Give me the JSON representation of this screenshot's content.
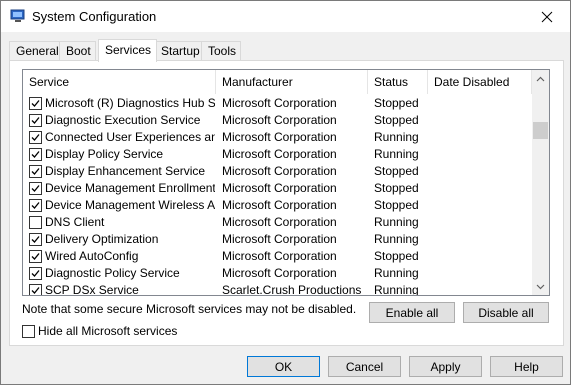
{
  "window": {
    "title": "System Configuration"
  },
  "tabs": [
    {
      "label": "General",
      "active": false
    },
    {
      "label": "Boot",
      "active": false
    },
    {
      "label": "Services",
      "active": true
    },
    {
      "label": "Startup",
      "active": false
    },
    {
      "label": "Tools",
      "active": false
    }
  ],
  "table": {
    "columns": [
      "Service",
      "Manufacturer",
      "Status",
      "Date Disabled"
    ],
    "rows": [
      {
        "checked": true,
        "service": "Microsoft (R) Diagnostics Hub St...",
        "manufacturer": "Microsoft Corporation",
        "status": "Stopped",
        "date_disabled": ""
      },
      {
        "checked": true,
        "service": "Diagnostic Execution Service",
        "manufacturer": "Microsoft Corporation",
        "status": "Stopped",
        "date_disabled": ""
      },
      {
        "checked": true,
        "service": "Connected User Experiences an...",
        "manufacturer": "Microsoft Corporation",
        "status": "Running",
        "date_disabled": ""
      },
      {
        "checked": true,
        "service": "Display Policy Service",
        "manufacturer": "Microsoft Corporation",
        "status": "Running",
        "date_disabled": ""
      },
      {
        "checked": true,
        "service": "Display Enhancement Service",
        "manufacturer": "Microsoft Corporation",
        "status": "Stopped",
        "date_disabled": ""
      },
      {
        "checked": true,
        "service": "Device Management Enrollment ...",
        "manufacturer": "Microsoft Corporation",
        "status": "Stopped",
        "date_disabled": ""
      },
      {
        "checked": true,
        "service": "Device Management Wireless Ap...",
        "manufacturer": "Microsoft Corporation",
        "status": "Stopped",
        "date_disabled": ""
      },
      {
        "checked": false,
        "service": "DNS Client",
        "manufacturer": "Microsoft Corporation",
        "status": "Running",
        "date_disabled": ""
      },
      {
        "checked": true,
        "service": "Delivery Optimization",
        "manufacturer": "Microsoft Corporation",
        "status": "Running",
        "date_disabled": ""
      },
      {
        "checked": true,
        "service": "Wired AutoConfig",
        "manufacturer": "Microsoft Corporation",
        "status": "Stopped",
        "date_disabled": ""
      },
      {
        "checked": true,
        "service": "Diagnostic Policy Service",
        "manufacturer": "Microsoft Corporation",
        "status": "Running",
        "date_disabled": ""
      },
      {
        "checked": true,
        "service": "SCP DSx Service",
        "manufacturer": "Scarlet.Crush Productions",
        "status": "Running",
        "date_disabled": ""
      }
    ]
  },
  "note": "Note that some secure Microsoft services may not be disabled.",
  "buttons": {
    "enable_all": "Enable all",
    "disable_all": "Disable all",
    "ok": "OK",
    "cancel": "Cancel",
    "apply": "Apply",
    "help": "Help"
  },
  "hide_ms": {
    "label": "Hide all Microsoft services",
    "checked": false
  },
  "icons": {
    "app": "system-configuration-icon",
    "close": "close-icon",
    "check": "checkmark-icon",
    "scroll_up": "chevron-up-icon",
    "scroll_down": "chevron-down-icon"
  },
  "colors": {
    "default_button_border": "#0078d7",
    "scroll_thumb": "#cdcdcd"
  }
}
